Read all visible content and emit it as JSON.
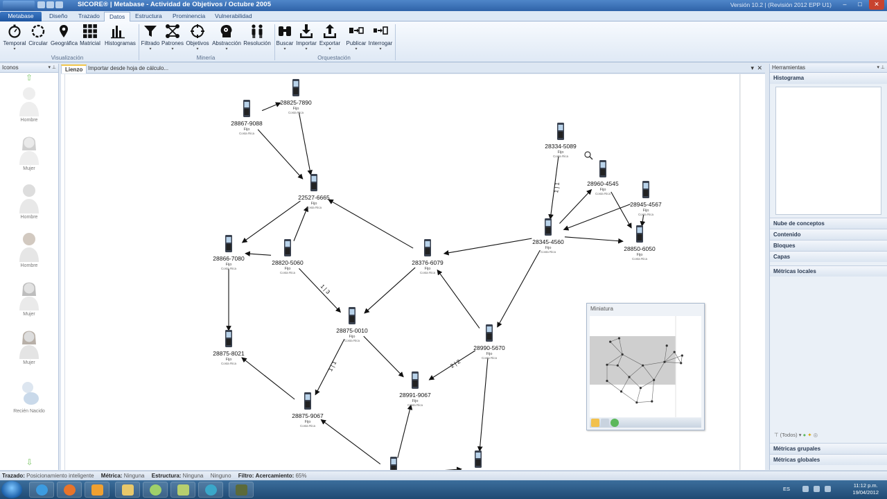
{
  "window": {
    "title": "SICORE® | Metabase - Actividad de Objetivos / Octubre 2005",
    "version": "Versión 10.2 | (Revisión 2012 EPP U1)",
    "controls": {
      "minimize": "–",
      "maximize": "□",
      "close": "✕"
    }
  },
  "ribbon": {
    "tabs": [
      "Metabase",
      "Diseño",
      "Trazado",
      "Datos",
      "Estructura",
      "Prominencia",
      "Vulnerabilidad"
    ],
    "active_tab": "Datos",
    "buttons": [
      {
        "label": "Temporal",
        "icon": "stopwatch-icon",
        "dropdown": true
      },
      {
        "label": "Circular",
        "icon": "circle-layout-icon",
        "dropdown": false
      },
      {
        "label": "Geográfica",
        "icon": "map-pin-icon",
        "dropdown": false
      },
      {
        "label": "Matricial",
        "icon": "grid-icon",
        "dropdown": false
      },
      {
        "label": "Histogramas",
        "icon": "bar-chart-icon",
        "dropdown": false
      },
      {
        "label": "Filtrado",
        "icon": "funnel-icon",
        "dropdown": true
      },
      {
        "label": "Patrones",
        "icon": "network-pattern-icon",
        "dropdown": true
      },
      {
        "label": "Objetivos",
        "icon": "crosshair-icon",
        "dropdown": true
      },
      {
        "label": "Abstracción",
        "icon": "head-gears-icon",
        "dropdown": true
      },
      {
        "label": "Resolución",
        "icon": "people-icon",
        "dropdown": false
      },
      {
        "label": "Buscar",
        "icon": "binoculars-icon",
        "dropdown": true
      },
      {
        "label": "Importar",
        "icon": "import-icon",
        "dropdown": true
      },
      {
        "label": "Exportar",
        "icon": "export-icon",
        "dropdown": true
      },
      {
        "label": "Publicar",
        "icon": "publish-icon",
        "dropdown": true
      },
      {
        "label": "Interrogar",
        "icon": "query-icon",
        "dropdown": true
      }
    ],
    "groups": [
      "Visualización",
      "Minería",
      "Orquestación"
    ]
  },
  "left_panel": {
    "title": "Iconos",
    "items": [
      "Hombre",
      "Mujer",
      "Hombre",
      "Hombre",
      "Mujer",
      "Mujer",
      "Recién Nacido"
    ]
  },
  "document_tabs": [
    "Lienzo",
    "Importar desde hoja de cálculo..."
  ],
  "graph": {
    "nodes": [
      {
        "id": "28825-7890",
        "type": "Fijo",
        "country": "Costa Rica"
      },
      {
        "id": "28867-9088",
        "type": "Fijo",
        "country": "Costa Rica"
      },
      {
        "id": "22527-6665",
        "type": "Fijo",
        "country": "Costa Rica"
      },
      {
        "id": "28866-7080",
        "type": "Fijo",
        "country": "Costa Rica"
      },
      {
        "id": "28820-5060",
        "type": "Fijo",
        "country": "Costa Rica"
      },
      {
        "id": "28376-6079",
        "type": "Fijo",
        "country": "Costa Rica"
      },
      {
        "id": "28875-0010",
        "type": "Fijo",
        "country": "Costa Rica"
      },
      {
        "id": "28875-8021",
        "type": "Fijo",
        "country": "Costa Rica"
      },
      {
        "id": "28875-9067",
        "type": "Fijo",
        "country": "Costa Rica"
      },
      {
        "id": "28991-9067",
        "type": "Fijo",
        "country": "Costa Rica"
      },
      {
        "id": "28990-5670",
        "type": "Fijo",
        "country": "Costa Rica"
      },
      {
        "id": "28334-5089",
        "type": "Fijo",
        "country": "Costa Rica"
      },
      {
        "id": "28960-4545",
        "type": "Fijo",
        "country": "Costa Rica"
      },
      {
        "id": "28945-4567",
        "type": "Fijo",
        "country": "Costa Rica"
      },
      {
        "id": "28345-4560",
        "type": "Fijo",
        "country": "Costa Rica"
      },
      {
        "id": "28850-6050",
        "type": "Fijo",
        "country": "Costa Rica"
      },
      {
        "id": "",
        "type": "",
        "country": ""
      },
      {
        "id": "",
        "type": "",
        "country": ""
      }
    ],
    "edges": [
      {
        "from": 1,
        "to": 0,
        "label": ""
      },
      {
        "from": 1,
        "to": 2,
        "label": ""
      },
      {
        "from": 0,
        "to": 2,
        "label": ""
      },
      {
        "from": 2,
        "to": 3,
        "label": ""
      },
      {
        "from": 4,
        "to": 3,
        "label": ""
      },
      {
        "from": 4,
        "to": 2,
        "label": ""
      },
      {
        "from": 5,
        "to": 2,
        "label": ""
      },
      {
        "from": 3,
        "to": 7,
        "label": ""
      },
      {
        "from": 4,
        "to": 6,
        "label": "1 | 3"
      },
      {
        "from": 5,
        "to": 6,
        "label": ""
      },
      {
        "from": 14,
        "to": 5,
        "label": ""
      },
      {
        "from": 10,
        "to": 5,
        "label": ""
      },
      {
        "from": 6,
        "to": 8,
        "label": "1 | 1"
      },
      {
        "from": 6,
        "to": 9,
        "label": ""
      },
      {
        "from": 10,
        "to": 9,
        "label": "2 | 2"
      },
      {
        "from": 8,
        "to": 7,
        "label": ""
      },
      {
        "from": 11,
        "to": 14,
        "label": "1 | 1"
      },
      {
        "from": 14,
        "to": 12,
        "label": ""
      },
      {
        "from": 13,
        "to": 14,
        "label": ""
      },
      {
        "from": 14,
        "to": 15,
        "label": ""
      },
      {
        "from": 12,
        "to": 15,
        "label": ""
      },
      {
        "from": 13,
        "to": 15,
        "label": ""
      },
      {
        "from": 14,
        "to": 10,
        "label": ""
      },
      {
        "from": 10,
        "to": 17,
        "label": ""
      },
      {
        "from": 16,
        "to": 8,
        "label": ""
      },
      {
        "from": 16,
        "to": 9,
        "label": ""
      },
      {
        "from": 16,
        "to": 17,
        "label": ""
      }
    ]
  },
  "minimap": {
    "title": "Miniatura"
  },
  "right_panel": {
    "title": "Herramientas",
    "sections": [
      "Histograma",
      "Nube de conceptos",
      "Contenido",
      "Bloques",
      "Capas",
      "Métricas locales"
    ],
    "toolbar_text": "(Todos)",
    "bottom_sections": [
      "Métricas grupales",
      "Métricas globales"
    ]
  },
  "status_bar": {
    "trazado_label": "Trazado:",
    "trazado_value": "Posicionamiento inteligente",
    "metrica_label": "Métrica:",
    "metrica_value": "Ninguna",
    "estructura_label": "Estructura:",
    "estructura_value": "Ninguna",
    "estructura_value2": "Ninguno",
    "filtro_label": "Filtro:",
    "acercamiento_label": "Acercamiento:",
    "acercamiento_value": "65%"
  },
  "taskbar": {
    "language": "ES",
    "time": "11:12 p.m.",
    "date": "19/04/2012",
    "apps": [
      "ie-icon",
      "firefox-icon",
      "media-player-icon",
      "explorer-icon",
      "talk-icon",
      "notes-icon",
      "network-app-icon",
      "sicore-icon"
    ]
  },
  "colors": {
    "accent": "#2f63a8",
    "edge": "#111111",
    "node_phone": "#3a4250"
  }
}
